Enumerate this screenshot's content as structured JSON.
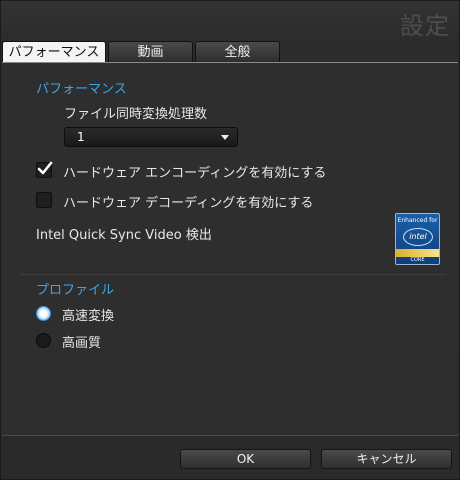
{
  "window": {
    "title": "設定"
  },
  "tabs": [
    {
      "label": "パフォーマンス",
      "active": true
    },
    {
      "label": "動画",
      "active": false
    },
    {
      "label": "全般",
      "active": false
    }
  ],
  "performance": {
    "section_title": "パフォーマンス",
    "concurrent_label": "ファイル同時変換処理数",
    "concurrent_value": "1",
    "hw_encode_label": "ハードウェア エンコーディングを有効にする",
    "hw_encode_checked": true,
    "hw_decode_label": "ハードウェア デコーディングを有効にする",
    "hw_decode_checked": false,
    "qsv_label": "Intel Quick Sync Video 検出",
    "intel_badge": {
      "top_text": "Enhanced for",
      "logo_text": "intel",
      "bottom_text": "CORE"
    }
  },
  "profile": {
    "section_title": "プロファイル",
    "options": [
      {
        "label": "高速変換",
        "selected": true
      },
      {
        "label": "高画質",
        "selected": false
      }
    ]
  },
  "footer": {
    "ok_label": "OK",
    "cancel_label": "キャンセル"
  },
  "colors": {
    "accent": "#3fa4e8",
    "background": "#2b2b2b"
  }
}
